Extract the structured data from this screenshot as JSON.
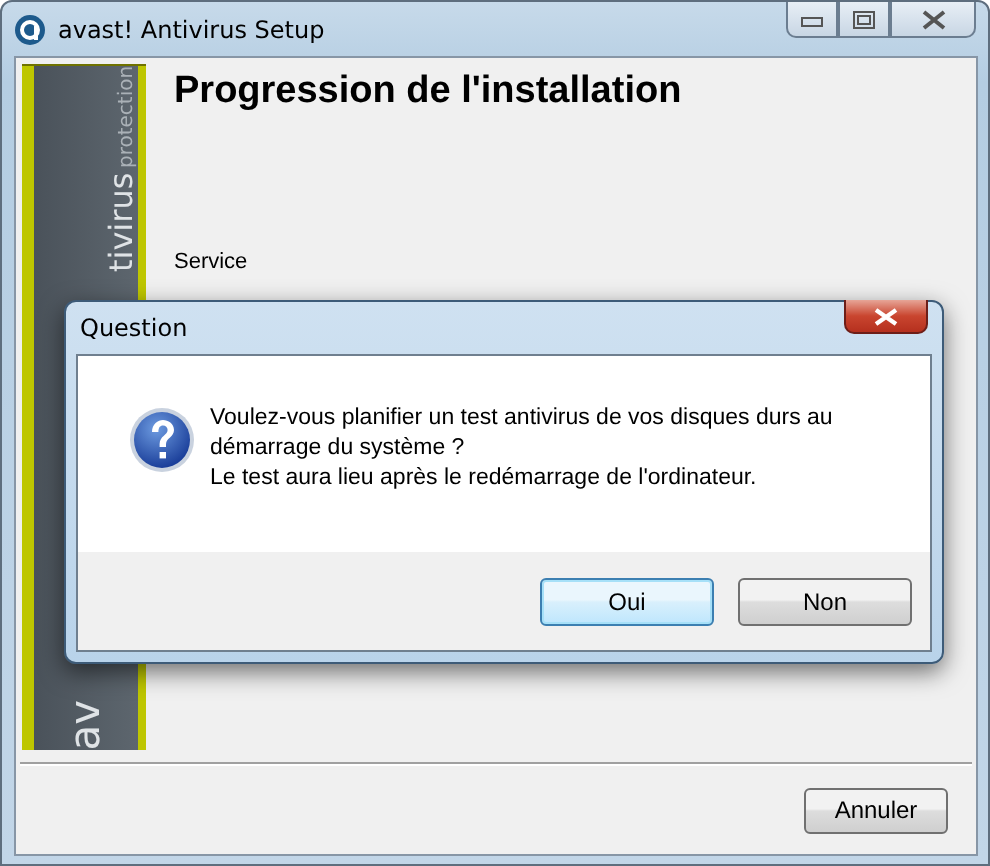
{
  "window": {
    "title": "avast! Antivirus Setup"
  },
  "banner": {
    "texts": [
      "tivirus",
      "protection"
    ],
    "logo_fragment": "av"
  },
  "heading": "Progression de l'installation",
  "status": "Service",
  "cancel_button": "Annuler",
  "dialog": {
    "title": "Question",
    "message": [
      "Voulez-vous planifier un test antivirus de vos disques durs au démarrage du système ?",
      "Le test aura lieu après le redémarrage de l'ordinateur."
    ],
    "buttons": [
      {
        "label": "Oui",
        "default": true
      },
      {
        "label": "Non",
        "default": false
      }
    ]
  }
}
